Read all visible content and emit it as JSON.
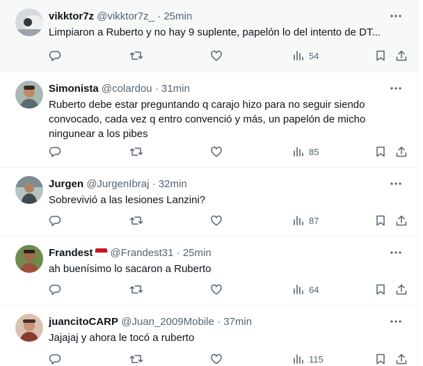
{
  "tweets": [
    {
      "name": "vikktor7z",
      "handle": "@vikktor7z_",
      "dot": "·",
      "time": "25min",
      "has_flag": false,
      "text": "Limpiaron a Ruberto y no hay 9 suplente, papelón lo del intento de DT...",
      "views": "54",
      "avatar_colors": [
        "#c9ccd0",
        "#2f3b47"
      ]
    },
    {
      "name": "Simonista",
      "handle": "@colardou",
      "dot": "·",
      "time": "31min",
      "has_flag": false,
      "text": "Ruberto debe estar preguntando q carajo hizo para no seguir siendo\nconvocado, cada vez q entro convenció y más, un papelón de micho\nningunear a los pibes",
      "views": "85",
      "avatar_colors": [
        "#8fa3a0",
        "#b77f5d"
      ]
    },
    {
      "name": "Jurgen",
      "handle": "@JurgenIbraj",
      "dot": "·",
      "time": "32min",
      "has_flag": false,
      "text": "Sobrevivió a las lesiones Lanzini?",
      "views": "87",
      "avatar_colors": [
        "#9aa7a3",
        "#3f4a52"
      ]
    },
    {
      "name": "Frandest",
      "handle": "@Frandest31",
      "dot": "·",
      "time": "25min",
      "has_flag": true,
      "text": "ah buenísimo lo sacaron a Ruberto",
      "views": "64",
      "avatar_colors": [
        "#5d7a3e",
        "#a04e3a"
      ]
    },
    {
      "name": "juancitoCARP",
      "handle": "@Juan_2009Mobile",
      "dot": "·",
      "time": "37min",
      "has_flag": false,
      "text": "Jajajaj y ahora le tocó a ruberto",
      "views": "115",
      "avatar_colors": [
        "#c9a98f",
        "#8b3b2e"
      ]
    }
  ],
  "icons": {
    "reply": "reply-icon",
    "retweet": "retweet-icon",
    "like": "heart-icon",
    "views": "views-icon",
    "bookmark": "bookmark-icon",
    "share": "share-icon",
    "more": "more-icon"
  },
  "colors": {
    "text": "#0f1419",
    "secondary": "#536471",
    "divider": "#eff3f4",
    "hover_bg": "#f7f9f9",
    "flag_red": "#ce1126"
  }
}
